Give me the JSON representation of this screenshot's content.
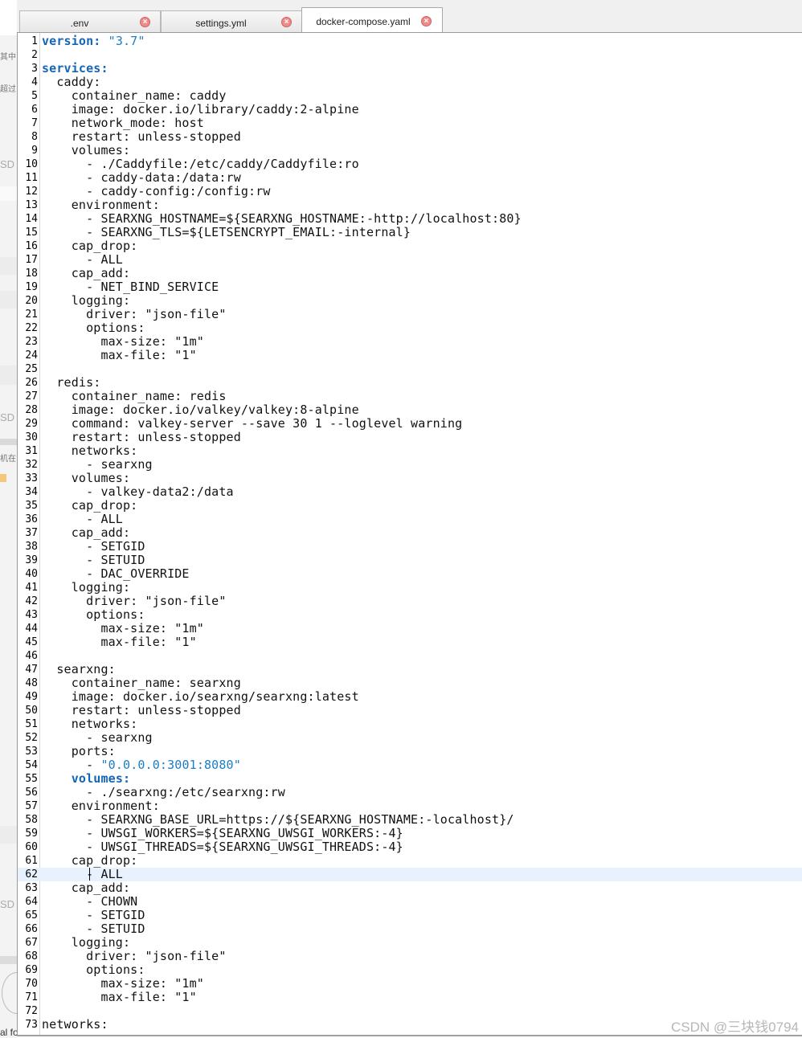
{
  "tabs": [
    {
      "label": ".env",
      "active": false
    },
    {
      "label": "settings.yml",
      "active": false
    },
    {
      "label": "docker-compose.yaml",
      "active": true
    }
  ],
  "background_window": {
    "snippets": [
      "其中",
      "超过",
      "SD",
      "SD",
      "机在",
      "SD",
      "al fo"
    ]
  },
  "editor": {
    "current_line": 62,
    "lines": [
      "version: \"3.7\"",
      "",
      "services:",
      "  caddy:",
      "    container_name: caddy",
      "    image: docker.io/library/caddy:2-alpine",
      "    network_mode: host",
      "    restart: unless-stopped",
      "    volumes:",
      "      - ./Caddyfile:/etc/caddy/Caddyfile:ro",
      "      - caddy-data:/data:rw",
      "      - caddy-config:/config:rw",
      "    environment:",
      "      - SEARXNG_HOSTNAME=${SEARXNG_HOSTNAME:-http://localhost:80}",
      "      - SEARXNG_TLS=${LETSENCRYPT_EMAIL:-internal}",
      "    cap_drop:",
      "      - ALL",
      "    cap_add:",
      "      - NET_BIND_SERVICE",
      "    logging:",
      "      driver: \"json-file\"",
      "      options:",
      "        max-size: \"1m\"",
      "        max-file: \"1\"",
      "",
      "  redis:",
      "    container_name: redis",
      "    image: docker.io/valkey/valkey:8-alpine",
      "    command: valkey-server --save 30 1 --loglevel warning",
      "    restart: unless-stopped",
      "    networks:",
      "      - searxng",
      "    volumes:",
      "      - valkey-data2:/data",
      "    cap_drop:",
      "      - ALL",
      "    cap_add:",
      "      - SETGID",
      "      - SETUID",
      "      - DAC_OVERRIDE",
      "    logging:",
      "      driver: \"json-file\"",
      "      options:",
      "        max-size: \"1m\"",
      "        max-file: \"1\"",
      "",
      "  searxng:",
      "    container_name: searxng",
      "    image: docker.io/searxng/searxng:latest",
      "    restart: unless-stopped",
      "    networks:",
      "      - searxng",
      "    ports:",
      "      - \"0.0.0.0:3001:8080\"",
      "    volumes:",
      "      - ./searxng:/etc/searxng:rw",
      "    environment:",
      "      - SEARXNG_BASE_URL=https://${SEARXNG_HOSTNAME:-localhost}/",
      "      - UWSGI_WORKERS=${SEARXNG_UWSGI_WORKERS:-4}",
      "      - UWSGI_THREADS=${SEARXNG_UWSGI_THREADS:-4}",
      "    cap_drop:",
      "      - ALL",
      "    cap_add:",
      "      - CHOWN",
      "      - SETGID",
      "      - SETUID",
      "    logging:",
      "      driver: \"json-file\"",
      "      options:",
      "        max-size: \"1m\"",
      "        max-file: \"1\"",
      "",
      "networks:"
    ],
    "keyword_lines": [
      1,
      3,
      55
    ],
    "string_lines": [
      1,
      54
    ]
  },
  "watermark": "CSDN @三块钱0794"
}
